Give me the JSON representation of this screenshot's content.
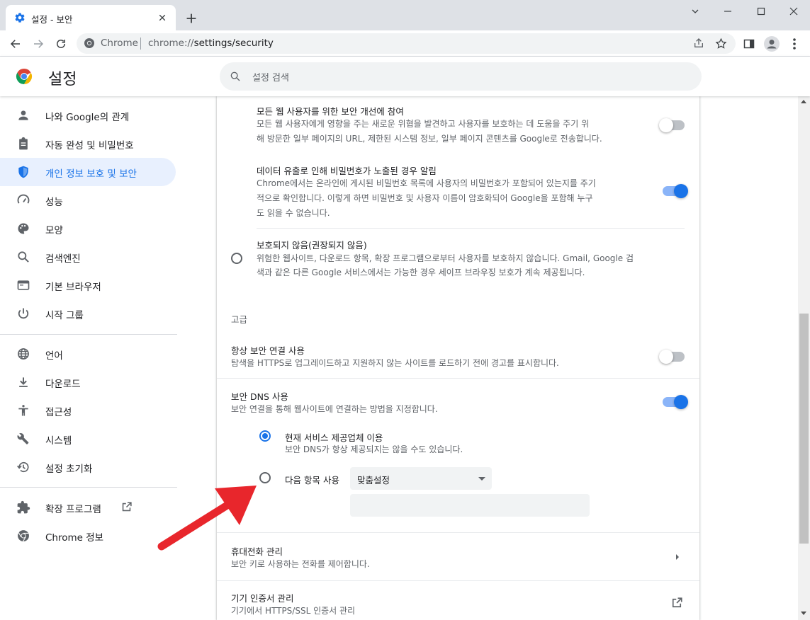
{
  "browser": {
    "tab_title": "설정 - 보안",
    "omnibox_site": "Chrome",
    "omnibox_url_scheme": "chrome://",
    "omnibox_url_path": "settings/security"
  },
  "header": {
    "title": "설정",
    "search_placeholder": "설정 검색"
  },
  "sidebar": {
    "items": [
      {
        "label": "나와 Google의 관계",
        "icon": "person-icon"
      },
      {
        "label": "자동 완성 및 비밀번호",
        "icon": "clipboard-icon"
      },
      {
        "label": "개인 정보 보호 및 보안",
        "icon": "shield-icon",
        "active": true
      },
      {
        "label": "성능",
        "icon": "speedometer-icon"
      },
      {
        "label": "모양",
        "icon": "palette-icon"
      },
      {
        "label": "검색엔진",
        "icon": "search-icon"
      },
      {
        "label": "기본 브라우저",
        "icon": "browser-icon"
      },
      {
        "label": "시작 그룹",
        "icon": "power-icon"
      },
      {
        "label": "언어",
        "icon": "globe-icon"
      },
      {
        "label": "다운로드",
        "icon": "download-icon"
      },
      {
        "label": "접근성",
        "icon": "accessibility-icon"
      },
      {
        "label": "시스템",
        "icon": "wrench-icon"
      },
      {
        "label": "설정 초기화",
        "icon": "restore-icon"
      },
      {
        "label": "확장 프로그램",
        "icon": "puzzle-icon"
      },
      {
        "label": "Chrome 정보",
        "icon": "chrome-icon"
      }
    ]
  },
  "main": {
    "improve_security": {
      "title": "모든 웹 사용자를 위한 보안 개선에 참여",
      "desc1": "모든 웹 사용자에게 영향을 주는 새로운 위협을 발견하고 사용자를 보호하는 데 도움을 주기 위",
      "desc2": "해 방문한 일부 페이지의 URL, 제한된 시스템 정보, 일부 페이지 콘텐츠를 Google로 전송합니다.",
      "enabled": false
    },
    "password_leak": {
      "title": "데이터 유출로 인해 비밀번호가 노출된 경우 알림",
      "desc1": "Chrome에서는 온라인에 게시된 비밀번호 목록에 사용자의 비밀번호가 포함되어 있는지를 주기",
      "desc2": "적으로 확인합니다. 이렇게 하면 비밀번호 및 사용자 이름이 암호화되어 Google을 포함해 누구",
      "desc3": "도 읽을 수 없습니다.",
      "enabled": true
    },
    "no_protection": {
      "title": "보호되지 않음(권장되지 않음)",
      "desc1": "위험한 웹사이트, 다운로드 항목, 확장 프로그램으로부터 사용자를 보호하지 않습니다. Gmail, Google 검",
      "desc2": "색과 같은 다른 Google 서비스에서는 가능한 경우 세이프 브라우징 보호가 계속 제공됩니다."
    },
    "advanced_heading": "고급",
    "always_secure": {
      "title": "항상 보안 연결 사용",
      "desc": "탐색을 HTTPS로 업그레이드하고 지원하지 않는 사이트를 로드하기 전에 경고를 표시합니다.",
      "enabled": false
    },
    "secure_dns": {
      "title": "보안 DNS 사용",
      "desc": "보안 연결을 통해 웹사이트에 연결하는 방법을 지정합니다.",
      "enabled": true,
      "option_current_title": "현재 서비스 제공업체 이용",
      "option_current_desc": "보안 DNS가 항상 제공되지는 않을 수도 있습니다.",
      "option_custom_label": "다음 항목 사용",
      "custom_select_value": "맞춤설정",
      "custom_input_value": ""
    },
    "phones": {
      "title": "휴대전화 관리",
      "desc": "보안 키로 사용하는 전화를 제어합니다."
    },
    "certificates": {
      "title": "기기 인증서 관리",
      "desc": "기기에서 HTTPS/SSL 인증서 관리"
    }
  },
  "colors": {
    "accent": "#1a73e8",
    "annotation_arrow": "#e8262c"
  }
}
